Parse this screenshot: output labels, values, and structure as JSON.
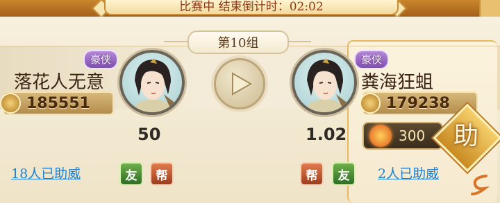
{
  "header": {
    "countdown_text": "比赛中 结束倒计时：02:02"
  },
  "match": {
    "group_label": "第10组"
  },
  "left_player": {
    "name": "落花人无意",
    "badge": "豪侠",
    "power": "185551",
    "odds": "50",
    "assist_text": "18人已助威",
    "tags": [
      "友",
      "帮"
    ]
  },
  "right_player": {
    "name": "粪海狂蛆",
    "badge": "豪侠",
    "power": "179238",
    "odds": "1.02",
    "assist_text": "2人已助威",
    "tags": [
      "帮",
      "友"
    ]
  },
  "bet": {
    "amount": "300",
    "assist_button_label": "助"
  },
  "colors": {
    "accent_gold": "#c98d34",
    "link_blue": "#1f7fd0",
    "badge_purple": "#7f4fae"
  }
}
